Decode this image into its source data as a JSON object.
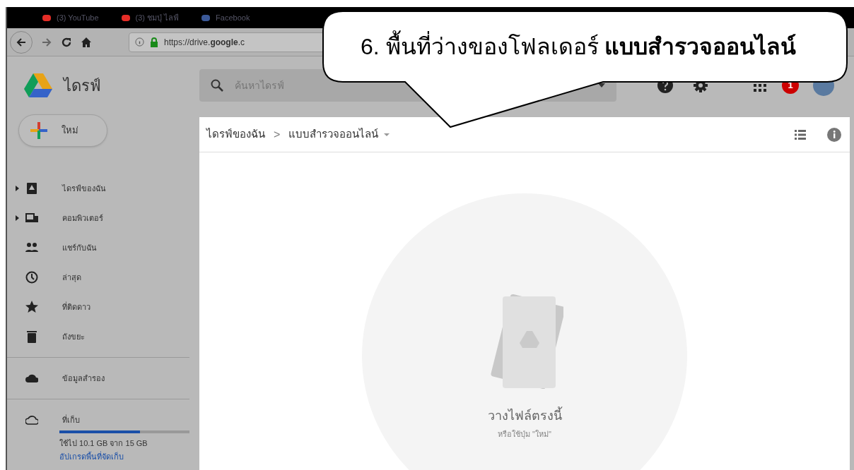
{
  "bookmarks": [
    {
      "label": "(3) YouTube",
      "color": "#e52d27"
    },
    {
      "label": "(3) ชมปุ่ ไลฟ์",
      "color": "#e52d27"
    },
    {
      "label": "Facebook",
      "color": "#3b5998"
    }
  ],
  "browser": {
    "url": "https://drive.**google**.c"
  },
  "drive": {
    "title": "ไดรฟ์",
    "search": {
      "placeholder": "ค้นหาไดรฟ์"
    },
    "notification_count": "1"
  },
  "new_button": "ใหม่",
  "sidebar": {
    "sections": [
      [
        {
          "kind": "drive",
          "label": "ไดรฟ์ของฉัน",
          "expandable": true
        },
        {
          "kind": "computer",
          "label": "คอมพิวเตอร์",
          "expandable": true
        },
        {
          "kind": "shared",
          "label": "แชร์กับฉัน",
          "expandable": false
        },
        {
          "kind": "recent",
          "label": "ล่าสุด",
          "expandable": false
        },
        {
          "kind": "starred",
          "label": "ที่ติดดาว",
          "expandable": false
        },
        {
          "kind": "trash",
          "label": "ถังขยะ",
          "expandable": false
        }
      ],
      [
        {
          "kind": "backup",
          "label": "ข้อมูลสำรอง",
          "expandable": false
        }
      ],
      [
        {
          "kind": "storage",
          "label": "ที่เก็บ",
          "expandable": false
        }
      ]
    ],
    "storage": {
      "level": 0.62,
      "usage": "ใช้ไป 10.1 GB จาก 15 GB",
      "upgrade": "อัปเกรดพื้นที่จัดเก็บ"
    }
  },
  "breadcrumb": {
    "separator": ">",
    "items": [
      "ไดรฟ์ของฉัน",
      "แบบสำรวจออนไลน์"
    ]
  },
  "empty_state": {
    "title": "วางไฟล์ตรงนี้",
    "hint": "หรือใช้ปุ่ม \"ใหม่\""
  },
  "callout": "6. พื้นที่ว่างของโฟลเดอร์ **แบบสำรวจออนไลน์**"
}
